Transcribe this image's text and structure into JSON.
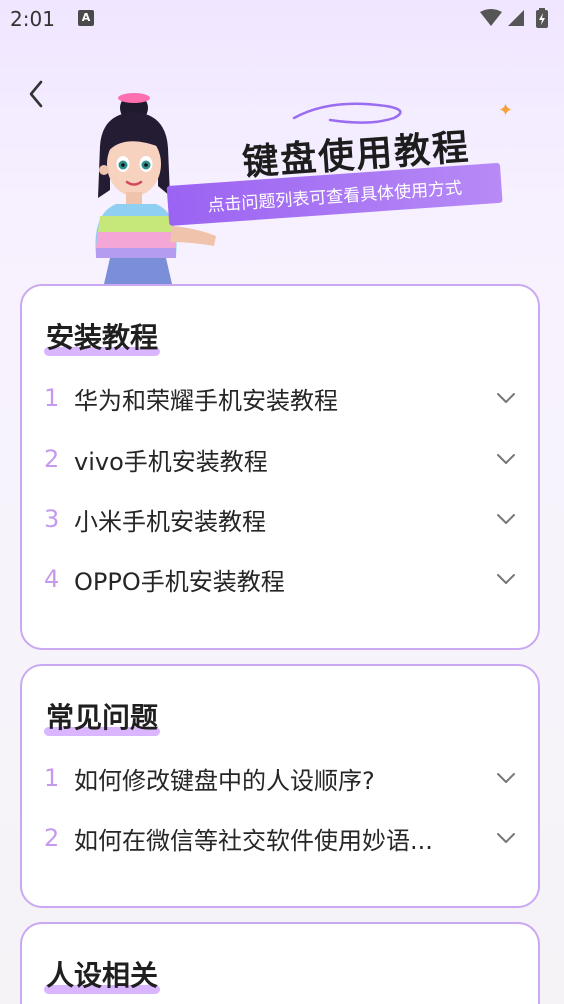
{
  "status_bar": {
    "time": "2:01",
    "notification_badge": "A",
    "icons": [
      "wifi-icon",
      "signal-icon",
      "battery-icon"
    ]
  },
  "header": {
    "back_icon": "chevron-left-icon",
    "title": "键盘使用教程",
    "subtitle": "点击问题列表可查看具体使用方式"
  },
  "colors": {
    "accent": "#c9a9f1",
    "number": "#c59aee",
    "highlight": "#d9b6ff",
    "ribbon": "#a36cf3"
  },
  "sections": [
    {
      "title": "安装教程",
      "items": [
        {
          "number": "1",
          "label": "华为和荣耀手机安装教程"
        },
        {
          "number": "2",
          "label": "vivo手机安装教程"
        },
        {
          "number": "3",
          "label": "小米手机安装教程"
        },
        {
          "number": "4",
          "label": "OPPO手机安装教程"
        }
      ]
    },
    {
      "title": "常见问题",
      "items": [
        {
          "number": "1",
          "label": "如何修改键盘中的人设顺序?"
        },
        {
          "number": "2",
          "label": "如何在微信等社交软件使用妙语..."
        }
      ]
    },
    {
      "title": "人设相关",
      "items": []
    }
  ]
}
